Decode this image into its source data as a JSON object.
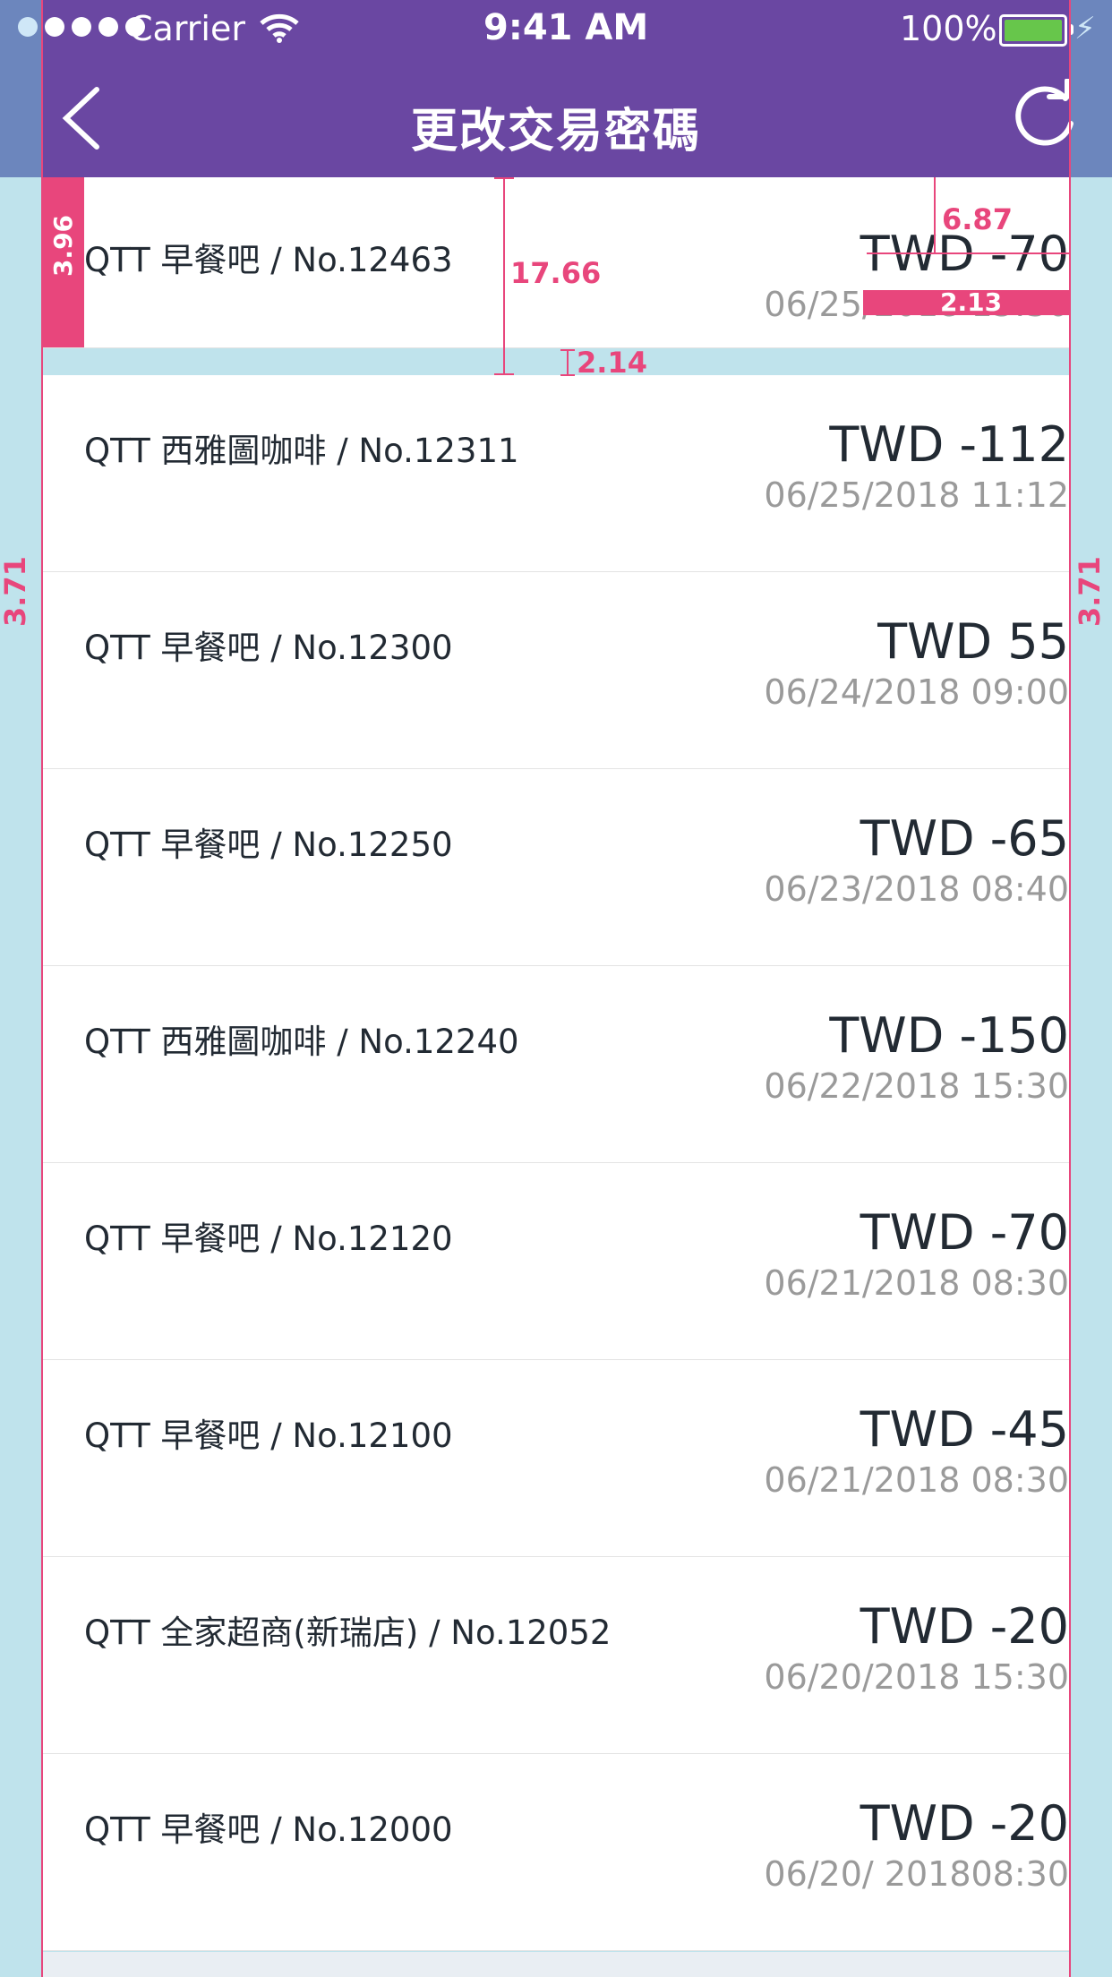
{
  "status_bar": {
    "carrier": "Carrier",
    "time": "9:41 AM",
    "battery_pct": "100%",
    "battery_color": "#67c64b"
  },
  "header": {
    "title": "更改交易密碼",
    "back_icon": "chevron-left-icon",
    "refresh_icon": "refresh-icon",
    "bg_color": "#6a47a2"
  },
  "transactions": [
    {
      "merchant": "QTT 早餐吧 / No.12463",
      "amount": "TWD -70",
      "date": "06/25/2018 15:30"
    },
    {
      "merchant": "QTT 西雅圖咖啡 / No.12311",
      "amount": "TWD -112",
      "date": "06/25/2018 11:12"
    },
    {
      "merchant": "QTT 早餐吧 / No.12300",
      "amount": "TWD 55",
      "date": "06/24/2018 09:00"
    },
    {
      "merchant": "QTT 早餐吧 / No.12250",
      "amount": "TWD -65",
      "date": "06/23/2018 08:40"
    },
    {
      "merchant": "QTT 西雅圖咖啡 / No.12240",
      "amount": "TWD -150",
      "date": "06/22/2018 15:30"
    },
    {
      "merchant": "QTT 早餐吧 / No.12120",
      "amount": "TWD -70",
      "date": "06/21/2018 08:30"
    },
    {
      "merchant": "QTT 早餐吧 / No.12100",
      "amount": "TWD -45",
      "date": "06/21/2018 08:30"
    },
    {
      "merchant": "QTT 全家超商(新瑞店) / No.12052",
      "amount": "TWD -20",
      "date": "06/20/2018 15:30"
    },
    {
      "merchant": "QTT 早餐吧 / No.12000",
      "amount": "TWD -20",
      "date": "06/20/ 201808:30"
    }
  ],
  "spec_annotations": {
    "left_bar": "3.96",
    "height": "17.66",
    "top_gap": "6.87",
    "amount_gap": "2.13",
    "row_gap": "2.14",
    "margin_left": "3.71",
    "margin_right": "3.71",
    "accent_color": "#e8467c"
  }
}
